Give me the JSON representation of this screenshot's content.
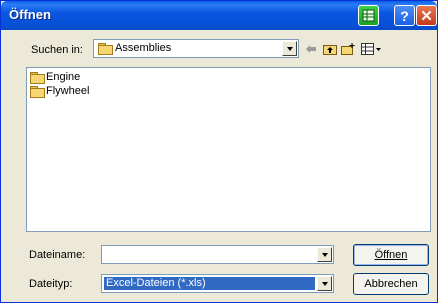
{
  "window": {
    "title": "Öffnen"
  },
  "toolbar": {
    "look_in_label": "Suchen in:",
    "look_in_value": "Assemblies"
  },
  "files": [
    {
      "name": "Engine",
      "icon": "folder-icon"
    },
    {
      "name": "Flywheel",
      "icon": "folder-icon"
    }
  ],
  "filename": {
    "label": "Dateiname:",
    "value": ""
  },
  "filetype": {
    "label": "Dateityp:",
    "value": "Excel-Dateien (*.xls)"
  },
  "buttons": {
    "open": "Öffnen",
    "cancel": "Abbrechen"
  },
  "colors": {
    "titlebar": "#0b57e0",
    "selection": "#316ac5",
    "dialog_bg": "#ece9d8"
  }
}
